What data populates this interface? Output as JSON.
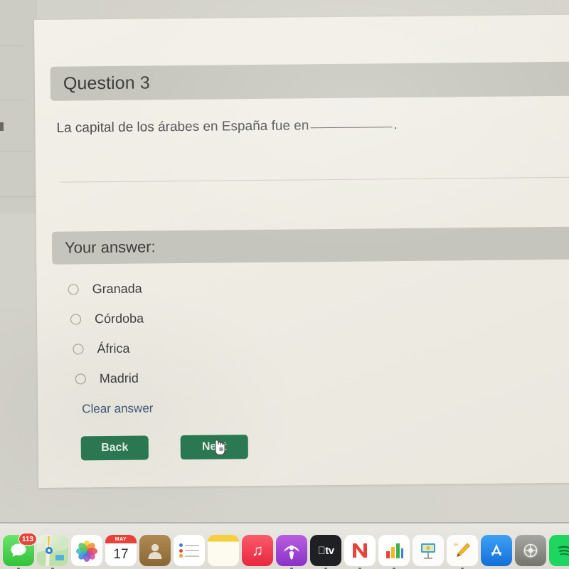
{
  "quiz": {
    "question_header": "Question 3",
    "question_text_before": "La capital de los árabes en España fue en",
    "question_text_after": ".",
    "answer_header": "Your answer:",
    "options": [
      {
        "label": "Granada",
        "selected": false
      },
      {
        "label": "Córdoba",
        "selected": false
      },
      {
        "label": "África",
        "selected": false
      },
      {
        "label": "Madrid",
        "selected": false
      }
    ],
    "clear_answer_label": "Clear answer",
    "back_button_label": "Back",
    "next_button_label": "Next",
    "colors": {
      "button_green": "#2b7a53",
      "link_blue": "#3f5a78",
      "band_gray": "#c5c5bd",
      "card_background": "#f0eee6"
    }
  },
  "cursor": {
    "type": "pointing-hand-cursor"
  },
  "dock": {
    "items": [
      {
        "name": "messages",
        "glyph": "",
        "badge": "113"
      },
      {
        "name": "maps",
        "glyph": ""
      },
      {
        "name": "photos",
        "glyph": ""
      },
      {
        "name": "calendar",
        "month": "MAY",
        "day": "17"
      },
      {
        "name": "contacts",
        "glyph": ""
      },
      {
        "name": "reminders",
        "glyph": ""
      },
      {
        "name": "notes",
        "glyph": ""
      },
      {
        "name": "music",
        "glyph": "♫"
      },
      {
        "name": "podcasts",
        "glyph": ""
      },
      {
        "name": "apple-tv",
        "glyph": "tv"
      },
      {
        "name": "news",
        "glyph": "N"
      },
      {
        "name": "numbers",
        "glyph": ""
      },
      {
        "name": "keynote",
        "glyph": ""
      },
      {
        "name": "pages",
        "glyph": ""
      },
      {
        "name": "app-store",
        "glyph": "A"
      },
      {
        "name": "system-preferences",
        "glyph": ""
      },
      {
        "name": "spotify",
        "glyph": ""
      }
    ]
  }
}
